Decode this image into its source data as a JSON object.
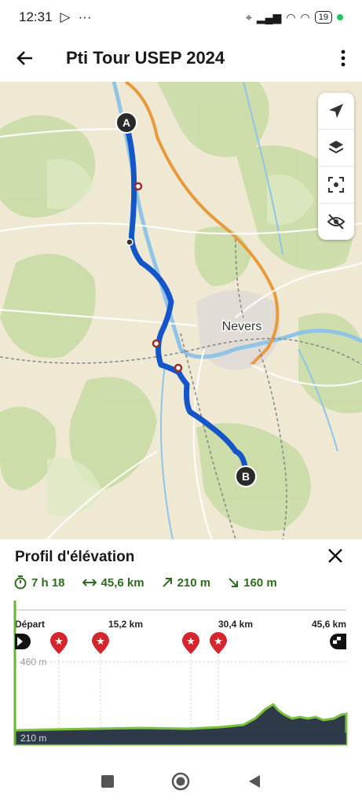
{
  "status": {
    "time": "12:31",
    "battery": "19"
  },
  "header": {
    "title": "Pti Tour USEP 2024"
  },
  "map": {
    "city_label": "Nevers",
    "start_marker": "A",
    "end_marker": "B"
  },
  "profile": {
    "title": "Profil d'élévation",
    "duration": "7 h 18",
    "distance": "45,6 km",
    "ascent": "210 m",
    "descent": "160 m",
    "x_labels": [
      "Départ",
      "15,2 km",
      "30,4 km",
      "45,6 km"
    ],
    "y_labels": [
      "460 m",
      "210 m"
    ]
  },
  "colors": {
    "route": "#1456c8",
    "accent": "#3a8a1e",
    "poi": "#d3262e"
  }
}
